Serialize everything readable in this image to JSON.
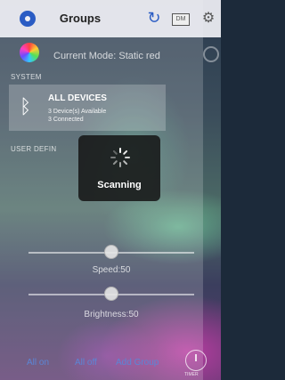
{
  "header": {
    "title": "Groups",
    "dm_label": "DM",
    "logo_icon": "group-logo-icon",
    "refresh_icon": "refresh-icon",
    "settings_icon": "gear-icon"
  },
  "mode": {
    "text": "Current Mode: Static red"
  },
  "sections": {
    "system": "SYSTEM",
    "user_defined": "USER DEFIN"
  },
  "device": {
    "title": "ALL DEVICES",
    "available": "3 Device(s) Available",
    "connected": "3 Connected",
    "icon": "bluetooth-icon"
  },
  "popup": {
    "text": "Scanning"
  },
  "sliders": {
    "speed_label": "Speed:50",
    "speed_value": 0.5,
    "brightness_label": "Brightness:50",
    "brightness_value": 0.5
  },
  "footer": {
    "all_on": "All on",
    "all_off": "All off",
    "add_group": "Add Group",
    "timer_label": "TIMER"
  }
}
